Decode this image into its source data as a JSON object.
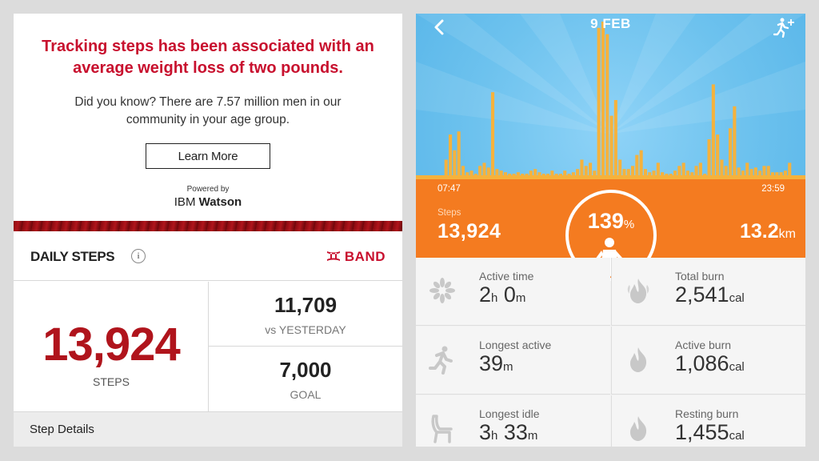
{
  "left": {
    "headline_line1": "Tracking steps has been associated with an",
    "headline_line2": "average weight loss of two pounds.",
    "subtext_line1": "Did you know? There are 7.57 million men in our",
    "subtext_line2": "community in your age group.",
    "learn_more": "Learn More",
    "powered_by": "Powered by",
    "ibm": "IBM ",
    "watson": "Watson",
    "daily_steps_title": "DAILY STEPS",
    "info_glyph": "i",
    "brand_logo": "⌘",
    "brand_text": "BAND",
    "steps_value": "13,924",
    "steps_label": "STEPS",
    "yesterday_value": "11,709",
    "yesterday_label": "vs YESTERDAY",
    "goal_value": "7,000",
    "goal_label": "GOAL",
    "step_details": "Step Details",
    "accent_color": "#c8102e"
  },
  "right": {
    "date": "9 FEB",
    "start_time": "07:47",
    "end_time": "23:59",
    "steps_label": "Steps",
    "steps_value": "13,924",
    "percent_value": "139",
    "percent_unit": "%",
    "distance_value": "13.2",
    "distance_unit": "km",
    "tiles": [
      {
        "icon": "sparkle-icon",
        "label": "Active time",
        "v1": "2",
        "u1": "h",
        "v2": " 0",
        "u2": "m"
      },
      {
        "icon": "flame-icon",
        "label": "Total burn",
        "v1": "2,541",
        "u1": "cal",
        "v2": "",
        "u2": ""
      },
      {
        "icon": "runner-icon",
        "label": "Longest active",
        "v1": "39",
        "u1": "m",
        "v2": "",
        "u2": ""
      },
      {
        "icon": "flame-icon",
        "label": "Active burn",
        "v1": "1,086",
        "u1": "cal",
        "v2": "",
        "u2": ""
      },
      {
        "icon": "chair-icon",
        "label": "Longest idle",
        "v1": "3",
        "u1": "h",
        "v2": " 33",
        "u2": "m"
      },
      {
        "icon": "flame-icon",
        "label": "Resting burn",
        "v1": "1,455",
        "u1": "cal",
        "v2": "",
        "u2": ""
      }
    ],
    "bar_color": "#f5b23d",
    "orange_color": "#f47b20",
    "activity_levels": [
      0,
      0,
      0,
      0,
      0.12,
      0.28,
      0.18,
      0.3,
      0.08,
      0.04,
      0.05,
      0.03,
      0.08,
      0.1,
      0.07,
      0.55,
      0.06,
      0.05,
      0.04,
      0.03,
      0.03,
      0.04,
      0.03,
      0.03,
      0.05,
      0.06,
      0.04,
      0.03,
      0.03,
      0.05,
      0.03,
      0.03,
      0.05,
      0.03,
      0.04,
      0.06,
      0.12,
      0.08,
      0.1,
      0.05,
      0.96,
      1.0,
      0.92,
      0.4,
      0.5,
      0.12,
      0.06,
      0.06,
      0.08,
      0.15,
      0.18,
      0.06,
      0.04,
      0.05,
      0.1,
      0.04,
      0.03,
      0.03,
      0.05,
      0.08,
      0.1,
      0.05,
      0.04,
      0.08,
      0.1,
      0.03,
      0.25,
      0.6,
      0.28,
      0.12,
      0.08,
      0.32,
      0.46,
      0.07,
      0.05,
      0.1,
      0.06,
      0.07,
      0.05,
      0.08,
      0.08,
      0.04,
      0.04,
      0.04,
      0.05,
      0.1
    ]
  }
}
